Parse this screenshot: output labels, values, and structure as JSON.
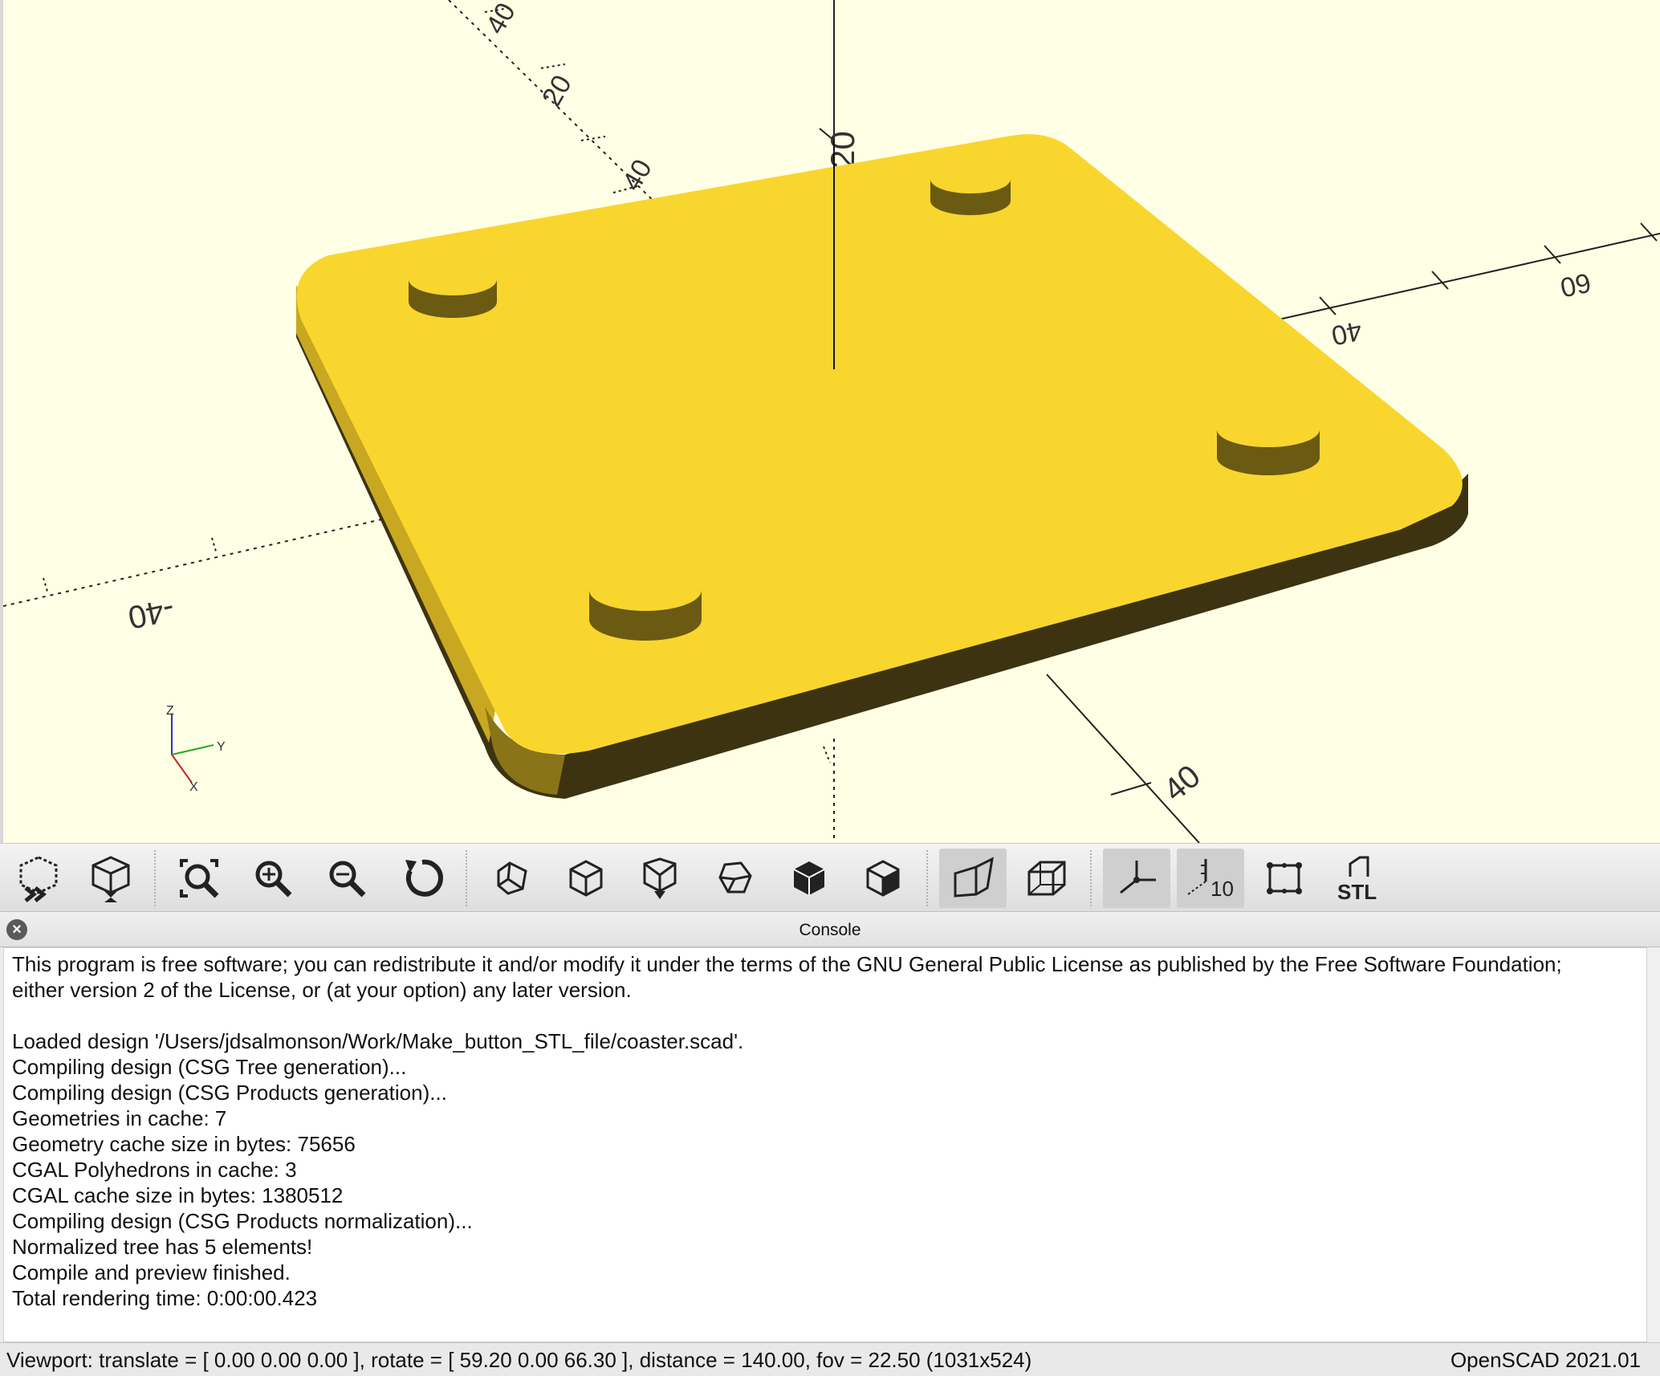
{
  "viewport": {
    "axis_ticks": {
      "x_neg": "-40",
      "x_pos": "40",
      "y_pos_near": "40",
      "y_pos_far": "60",
      "z_pos": "20",
      "y_neg_1": "40",
      "y_neg_2": "20",
      "y_neg_3": "40"
    },
    "gizmo": {
      "x": "X",
      "y": "Y",
      "z": "Z"
    },
    "colors": {
      "background": "#ffffe5",
      "model_top": "#f8d62e",
      "model_side": "#3d3310"
    }
  },
  "toolbar": {
    "buttons": [
      {
        "name": "render-button",
        "icon": "render-cube-icon"
      },
      {
        "name": "preview-button",
        "icon": "preview-hourglass-icon"
      },
      {
        "name": "view-all-button",
        "icon": "zoom-fit-icon"
      },
      {
        "name": "zoom-in-button",
        "icon": "zoom-in-icon"
      },
      {
        "name": "zoom-out-button",
        "icon": "zoom-out-icon"
      },
      {
        "name": "reset-view-button",
        "icon": "reset-icon"
      },
      {
        "name": "view-right-button",
        "icon": "view-right-icon"
      },
      {
        "name": "view-top-button",
        "icon": "view-top-icon"
      },
      {
        "name": "view-bottom-button",
        "icon": "view-bottom-icon"
      },
      {
        "name": "view-left-button",
        "icon": "view-left-icon"
      },
      {
        "name": "view-front-button",
        "icon": "view-front-icon"
      },
      {
        "name": "view-back-button",
        "icon": "view-back-icon"
      },
      {
        "name": "perspective-button",
        "icon": "perspective-icon"
      },
      {
        "name": "orthogonal-button",
        "icon": "orthogonal-icon"
      },
      {
        "name": "show-axes-button",
        "icon": "axes-icon"
      },
      {
        "name": "show-scale-button",
        "icon": "scale-markers-icon"
      },
      {
        "name": "show-edges-button",
        "icon": "edges-icon"
      },
      {
        "name": "export-stl-button",
        "icon": "stl-export-icon"
      }
    ],
    "scale_label": "10",
    "stl_label": "STL"
  },
  "console": {
    "title": "Console",
    "lines": [
      "This program is free software; you can redistribute it and/or modify it under the terms of the GNU General Public License as published by the Free Software Foundation;",
      "either version 2 of the License, or (at your option) any later version.",
      "",
      "Loaded design '/Users/jdsalmonson/Work/Make_button_STL_file/coaster.scad'.",
      "Compiling design (CSG Tree generation)...",
      "Compiling design (CSG Products generation)...",
      "Geometries in cache: 7",
      "Geometry cache size in bytes: 75656",
      "CGAL Polyhedrons in cache: 3",
      "CGAL cache size in bytes: 1380512",
      "Compiling design (CSG Products normalization)...",
      "Normalized tree has 5 elements!",
      "Compile and preview finished.",
      "Total rendering time: 0:00:00.423"
    ]
  },
  "status": {
    "viewport_info": "Viewport: translate = [ 0.00 0.00 0.00 ], rotate = [ 59.20 0.00 66.30 ], distance = 140.00, fov = 22.50 (1031x524)",
    "version": "OpenSCAD 2021.01"
  }
}
